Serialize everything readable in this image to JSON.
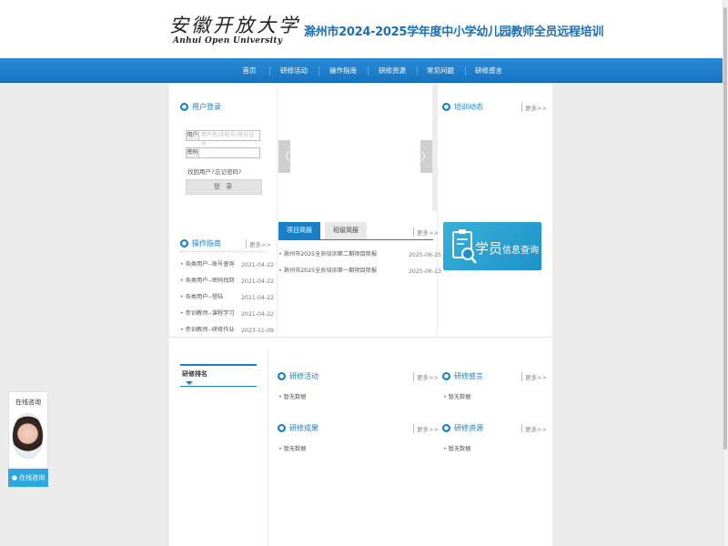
{
  "header": {
    "logo_cn": "安徽开放大学",
    "logo_en": "Anhui Open University",
    "site_title": "滁州市2024-2025学年度中小学幼儿园教师全员远程培训"
  },
  "nav": {
    "items": [
      "首页",
      "研修活动",
      "操作指南",
      "研修资源",
      "常见问题",
      "研修感言"
    ]
  },
  "login": {
    "title": "用户登录",
    "username_label": "用户",
    "username_placeholder": "用户名/手机号/身份证号",
    "password_label": "密码",
    "forgot_user": "找回用户?",
    "forgot_password": "忘记密码?",
    "login_button": "登 录"
  },
  "guide": {
    "title": "操作指南",
    "more": "更多>>",
    "items": [
      {
        "text": "各类用户--账号查询",
        "date": "2021-04-22"
      },
      {
        "text": "各类用户--密码找回",
        "date": "2021-04-22"
      },
      {
        "text": "各类用户--登陆",
        "date": "2021-04-22"
      },
      {
        "text": "参训教师--课程学习",
        "date": "2021-04-22"
      },
      {
        "text": "参训教师--研修作业",
        "date": "2023-11-09"
      }
    ]
  },
  "news": {
    "title": "培训动态",
    "more": "更多>>"
  },
  "carousel": {
    "prev": "〈",
    "next": "〉"
  },
  "briefs": {
    "tabs": [
      "项目简报",
      "班级简报"
    ],
    "more": "更多>>",
    "items": [
      {
        "text": "滁州市2025全员培训第二期项目简报",
        "date": "2025-06-25"
      },
      {
        "text": "滁州市2025全员培训第一期项目简报",
        "date": "2025-06-13"
      }
    ]
  },
  "banner": {
    "text_big": "学员",
    "text_small": "信息查询"
  },
  "ranking": {
    "title": "研修排名"
  },
  "sections": [
    {
      "title": "研修活动",
      "more": "更多>>",
      "empty": "暂无数据"
    },
    {
      "title": "研修感言",
      "more": "更多>>",
      "empty": "暂无数据"
    },
    {
      "title": "研修成果",
      "more": "更多>>",
      "empty": "暂无数据"
    },
    {
      "title": "研修资源",
      "more": "更多>>",
      "empty": "暂无数据"
    }
  ],
  "consult": {
    "title": "在线咨询",
    "button": "在线咨询"
  },
  "colors": {
    "brand_blue": "#1a7fc9",
    "nav_blue": "#1e7fcc",
    "banner_cyan": "#2ea7e0"
  }
}
